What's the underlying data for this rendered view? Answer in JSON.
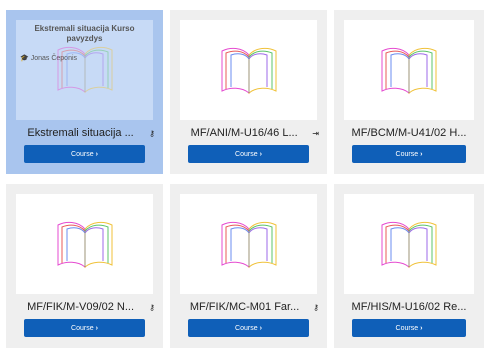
{
  "cards": [
    {
      "selected": true,
      "preview_title": "Ekstremali situacija Kurso pavyzdys",
      "teacher": "Jonas Čeponis",
      "name": "Ekstremali situacija ...",
      "icon": "key-icon",
      "button_label": "Course"
    },
    {
      "selected": false,
      "name": "MF/ANI/M-U16/46 L...",
      "icon": "enrol-icon",
      "button_label": "Course"
    },
    {
      "selected": false,
      "name": "MF/BCM/M-U41/02 H...",
      "icon": "",
      "button_label": "Course"
    },
    {
      "selected": false,
      "name": "MF/FIK/M-V09/02 N...",
      "icon": "key-icon",
      "button_label": "Course"
    },
    {
      "selected": false,
      "name": "MF/FIK/MC-M01 Far...",
      "icon": "key-icon",
      "button_label": "Course"
    },
    {
      "selected": false,
      "name": "MF/HIS/M-U16/02 Re...",
      "icon": "",
      "button_label": "Course"
    }
  ],
  "colors": {
    "button": "#0f5fb8",
    "card_bg": "#efefef",
    "selected_bg": "#a9c5ee"
  }
}
